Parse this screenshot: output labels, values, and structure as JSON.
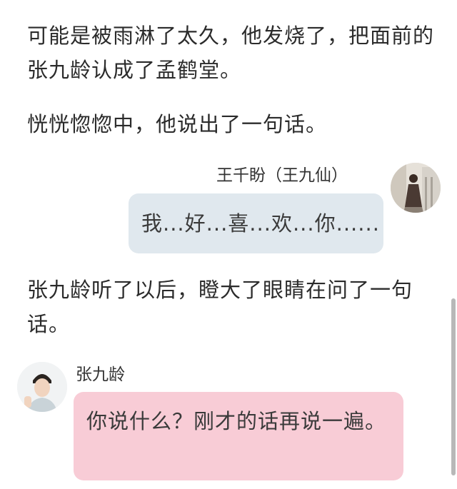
{
  "narration": {
    "p1": "可能是被雨淋了太久，他发烧了，把面前的张九龄认成了孟鹤堂。",
    "p2": "恍恍惚惚中，他说出了一句话。",
    "p3": "张九龄听了以后，瞪大了眼睛在问了一句话。"
  },
  "message_right": {
    "speaker": "王千盼（王九仙）",
    "text": "我...好...喜...欢...你......",
    "avatar_icon": "user-photo-avatar"
  },
  "message_left": {
    "speaker": "张九龄",
    "text": "你说什么？刚才的话再说一遍。",
    "avatar_icon": "user-photo-avatar"
  },
  "colors": {
    "bubble_right": "#e0e8ee",
    "bubble_left": "#f8ccd6",
    "text": "#2b2b2b"
  }
}
